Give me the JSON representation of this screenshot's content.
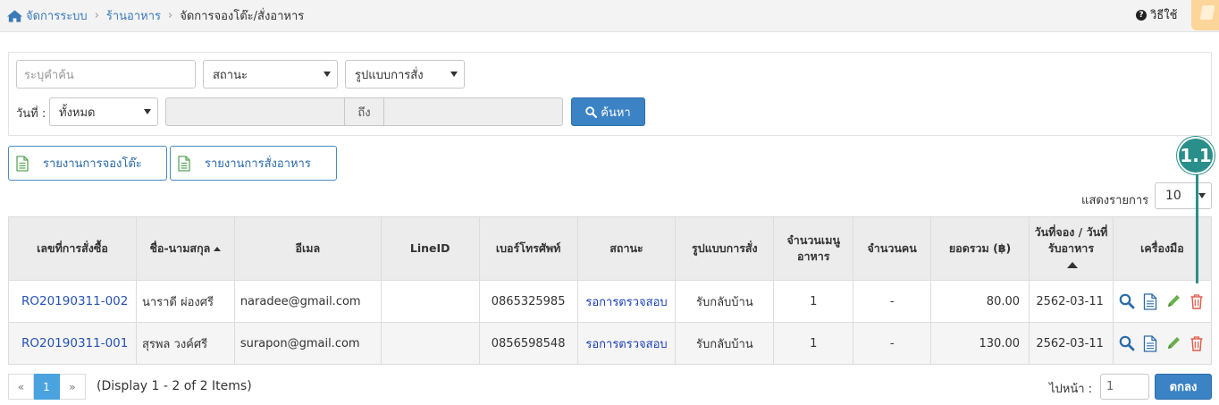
{
  "breadcrumb": {
    "items": [
      "จัดการระบบ",
      "ร้านอาหาร",
      "จัดการจองโต๊ะ/สั่งอาหาร"
    ]
  },
  "help": {
    "label": "วิธีใช้",
    "icon": "question-circle-icon"
  },
  "filters": {
    "search_placeholder": "ระบุคำค้น",
    "status_value": "สถานะ",
    "order_type_value": "รูปแบบการสั่ง",
    "date_label": "วันที่ :",
    "date_mode_value": "ทั้งหมด",
    "date_to_label": "ถึง",
    "search_button": "ค้นหา"
  },
  "report_buttons": [
    "รายงานการจองโต๊ะ",
    "รายงานการสั่งอาหาร"
  ],
  "page_size": {
    "label": "แสดงรายการ",
    "value": "10"
  },
  "annotation": "1.1",
  "table": {
    "headers": [
      "เลขที่การสั่งซื้อ",
      "ชื่อ-นามสกุล",
      "อีเมล",
      "LineID",
      "เบอร์โทรศัพท์",
      "สถานะ",
      "รูปแบบการสั่ง",
      "จำนวนเมนูอาหาร",
      "จำนวนคน",
      "ยอดรวม (฿)",
      "วันที่จอง / วันที่รับอาหาร",
      "เครื่องมือ"
    ],
    "rows": [
      {
        "order_no": "RO20190311-002",
        "name": "นาราดี ผ่องศรี",
        "email": "naradee@gmail.com",
        "line_id": "",
        "phone": "0865325985",
        "status": "รอการตรวจสอบ",
        "order_type": "รับกลับบ้าน",
        "menu_count": "1",
        "people": "-",
        "total": "80.00",
        "date": "2562-03-11"
      },
      {
        "order_no": "RO20190311-001",
        "name": "สุรพล วงค์ศรี",
        "email": "surapon@gmail.com",
        "line_id": "",
        "phone": "0856598548",
        "status": "รอการตรวจสอบ",
        "order_type": "รับกลับบ้าน",
        "menu_count": "1",
        "people": "-",
        "total": "130.00",
        "date": "2562-03-11"
      }
    ]
  },
  "pagination": {
    "prev": "«",
    "current": "1",
    "next": "»",
    "display_text": "(Display 1 - 2 of 2 Items)",
    "goto_label": "ไปหน้า :",
    "goto_value": "1",
    "goto_button": "ตกลง"
  },
  "colors": {
    "primary": "#3b83c4",
    "link": "#2552b5",
    "annotation": "#2a8f8a",
    "delete": "#e05a4a",
    "edit": "#6ab04c"
  }
}
